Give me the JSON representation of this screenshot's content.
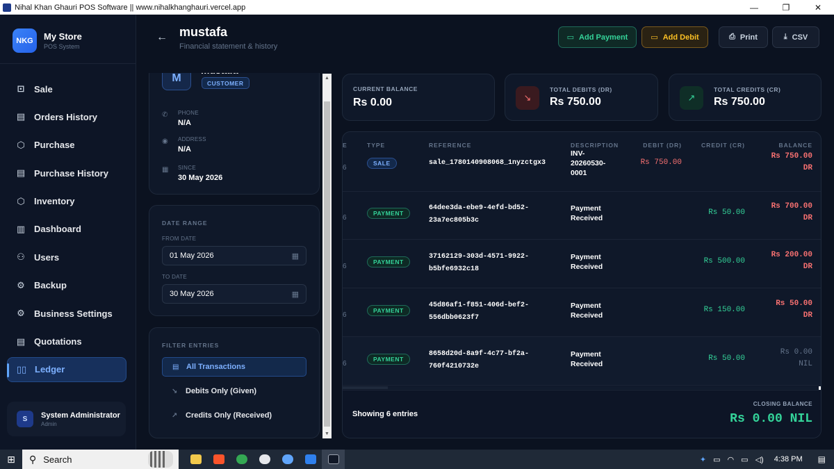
{
  "window": {
    "title": "Nihal Khan Ghauri POS Software || www.nihalkhanghauri.vercel.app",
    "minimize": "—",
    "maximize": "❐",
    "close": "✕"
  },
  "brand": {
    "logo": "NKG",
    "name": "My Store",
    "subtitle": "POS System"
  },
  "sidebar": {
    "items": [
      {
        "label": "Sale",
        "icon": "cart-icon",
        "glyph": "⊡"
      },
      {
        "label": "Orders History",
        "icon": "clipboard-icon",
        "glyph": "▤"
      },
      {
        "label": "Purchase",
        "icon": "package-icon",
        "glyph": "⬡"
      },
      {
        "label": "Purchase History",
        "icon": "clipboard-icon",
        "glyph": "▤"
      },
      {
        "label": "Inventory",
        "icon": "package-icon",
        "glyph": "⬡"
      },
      {
        "label": "Dashboard",
        "icon": "bar-chart-icon",
        "glyph": "▥"
      },
      {
        "label": "Users",
        "icon": "users-icon",
        "glyph": "⚇"
      },
      {
        "label": "Backup",
        "icon": "gear-icon",
        "glyph": "⚙"
      },
      {
        "label": "Business Settings",
        "icon": "gear-icon",
        "glyph": "⚙"
      },
      {
        "label": "Quotations",
        "icon": "clipboard-icon",
        "glyph": "▤"
      },
      {
        "label": "Ledger",
        "icon": "book-icon",
        "glyph": "▯▯",
        "active": true
      }
    ]
  },
  "user": {
    "initial": "S",
    "name": "System Administrator",
    "role": "Admin"
  },
  "header": {
    "title": "mustafa",
    "subtitle": "Financial statement & history",
    "add_payment": "Add Payment",
    "add_debit": "Add Debit",
    "print": "Print",
    "csv": "CSV"
  },
  "profile": {
    "initial": "M",
    "name": "mustafa",
    "badge": "CUSTOMER",
    "phone_label": "PHONE",
    "phone": "N/A",
    "address_label": "ADDRESS",
    "address": "N/A",
    "since_label": "SINCE",
    "since": "30 May 2026"
  },
  "date_range": {
    "title": "DATE RANGE",
    "from_label": "FROM DATE",
    "from": "01 May 2026",
    "to_label": "TO DATE",
    "to": "30 May 2026"
  },
  "filters": {
    "title": "FILTER ENTRIES",
    "items": [
      {
        "label": "All Transactions",
        "active": true
      },
      {
        "label": "Debits Only (Given)"
      },
      {
        "label": "Credits Only (Received)"
      }
    ]
  },
  "summary": {
    "current_balance_label": "CURRENT BALANCE",
    "current_balance": "Rs 0.00",
    "total_debits_label": "TOTAL DEBITS (DR)",
    "total_debits": "Rs 750.00",
    "total_credits_label": "TOTAL CREDITS (CR)",
    "total_credits": "Rs 750.00",
    "debits_color": "#f87171",
    "credits_color": "#34d399"
  },
  "table": {
    "columns": {
      "cut": "E",
      "type": "TYPE",
      "reference": "REFERENCE",
      "description": "DESCRIPTION",
      "debit": "DEBIT (DR)",
      "credit": "CREDIT (CR)",
      "balance": "BALANCE"
    },
    "rows": [
      {
        "cut": "6",
        "type": "SALE",
        "ref1": "sale_1780140908068_1nyzctgx3",
        "ref2": "",
        "desc": "INV-20260530-0001",
        "debit": "Rs 750.00",
        "credit": "",
        "bal1": "Rs 750.00",
        "bal2": "DR"
      },
      {
        "cut": "6",
        "type": "PAYMENT",
        "ref1": "64dee3da-ebe9-4efd-bd52-",
        "ref2": "23a7ec805b3c",
        "desc": "Payment Received",
        "debit": "",
        "credit": "Rs 50.00",
        "bal1": "Rs 700.00",
        "bal2": "DR"
      },
      {
        "cut": "6",
        "type": "PAYMENT",
        "ref1": "37162129-303d-4571-9922-",
        "ref2": "b5bfe6932c18",
        "desc": "Payment Received",
        "debit": "",
        "credit": "Rs 500.00",
        "bal1": "Rs 200.00",
        "bal2": "DR"
      },
      {
        "cut": "6",
        "type": "PAYMENT",
        "ref1": "45d86af1-f851-406d-bef2-",
        "ref2": "556dbb0623f7",
        "desc": "Payment Received",
        "debit": "",
        "credit": "Rs 150.00",
        "bal1": "Rs 50.00",
        "bal2": "DR"
      },
      {
        "cut": "6",
        "type": "PAYMENT",
        "ref1": "8658d20d-8a9f-4c77-bf2a-",
        "ref2": "760f4210732e",
        "desc": "Payment Received",
        "debit": "",
        "credit": "Rs 50.00",
        "bal1": "Rs 0.00",
        "bal2": "NIL"
      }
    ],
    "showing": "Showing 6 entries",
    "closing_label": "CLOSING BALANCE",
    "closing_value": "Rs 0.00 NIL"
  },
  "taskbar": {
    "search": "Search",
    "time": "4:38 PM"
  }
}
